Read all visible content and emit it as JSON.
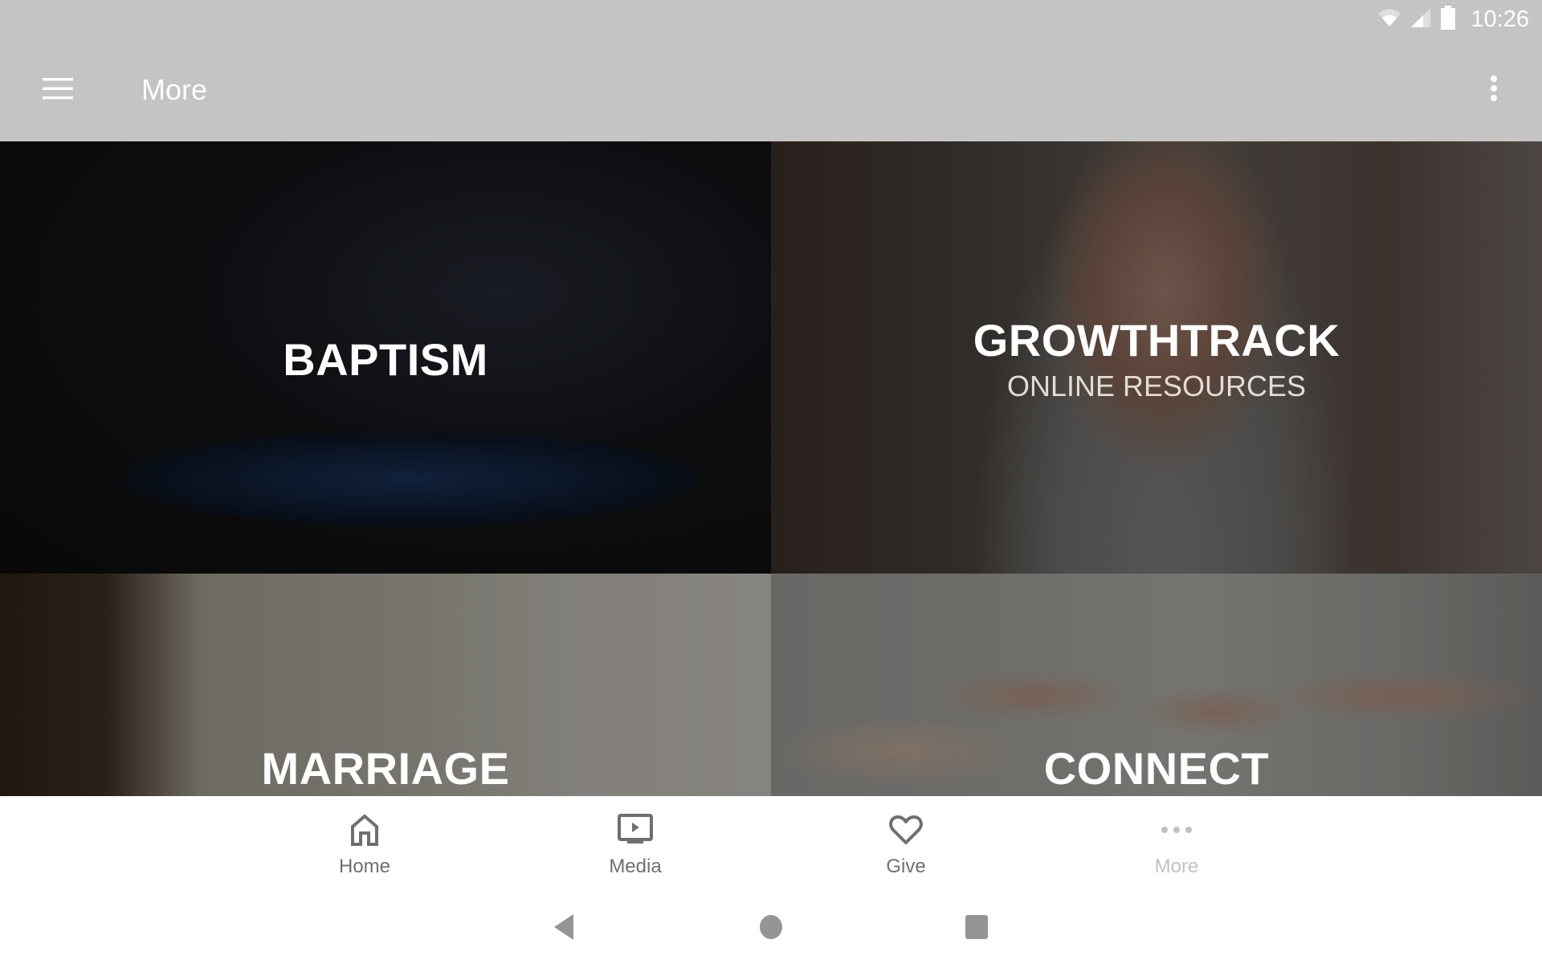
{
  "status_bar": {
    "time": "10:26",
    "icons": [
      "wifi-icon",
      "cell-signal-icon",
      "battery-icon"
    ]
  },
  "app_bar": {
    "title": "More",
    "menu_icon": "hamburger-menu-icon",
    "overflow_icon": "more-vert-icon"
  },
  "tiles": [
    {
      "title": "BAPTISM",
      "subtitle": ""
    },
    {
      "title": "GROWTHTRACK",
      "subtitle": "ONLINE RESOURCES"
    },
    {
      "title": "MARRIAGE",
      "subtitle": ""
    },
    {
      "title": "CONNECT",
      "subtitle": ""
    }
  ],
  "bottom_nav": {
    "items": [
      {
        "label": "Home",
        "icon": "home-icon",
        "active": false
      },
      {
        "label": "Media",
        "icon": "tv-play-icon",
        "active": false
      },
      {
        "label": "Give",
        "icon": "heart-icon",
        "active": false
      },
      {
        "label": "More",
        "icon": "more-horiz-icon",
        "active": true
      }
    ],
    "inactive_color": "#6f6f6f",
    "active_color": "#c2c2c2"
  },
  "system_nav": {
    "buttons": [
      "back",
      "home",
      "recents"
    ]
  },
  "colors": {
    "app_bar": "#c4c4c4",
    "nav_background": "#ffffff"
  }
}
